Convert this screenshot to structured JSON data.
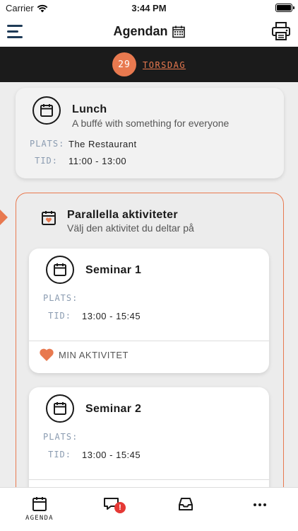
{
  "status": {
    "carrier": "Carrier",
    "time": "3:44 PM"
  },
  "header": {
    "title": "Agendan"
  },
  "date": {
    "day_number": "29",
    "weekday": "TORSDAG"
  },
  "lunch": {
    "title": "Lunch",
    "subtitle": "A buffé with something for everyone",
    "place_label": "PLATS:",
    "place": "The Restaurant",
    "time_label": "TID:",
    "time": "11:00 - 13:00"
  },
  "parallel": {
    "title": "Parallella aktiviteter",
    "subtitle": "Välj den aktivitet du deltar på",
    "sessions": [
      {
        "title": "Seminar 1",
        "place_label": "PLATS:",
        "place": "",
        "time_label": "TID:",
        "time": "13:00 - 15:45",
        "my_activity": "MIN AKTIVITET"
      },
      {
        "title": "Seminar 2",
        "place_label": "PLATS:",
        "place": "",
        "time_label": "TID:",
        "time": "13:00 - 15:45"
      }
    ]
  },
  "tabs": [
    {
      "icon": "calendar-icon",
      "label": "AGENDA"
    },
    {
      "icon": "chat-alert-icon",
      "label": "",
      "badge": "!"
    },
    {
      "icon": "inbox-icon",
      "label": ""
    },
    {
      "icon": "more-icon",
      "label": ""
    }
  ],
  "colors": {
    "accent": "#e8794f",
    "dark": "#1b1b1b",
    "navy": "#1f3b57"
  }
}
